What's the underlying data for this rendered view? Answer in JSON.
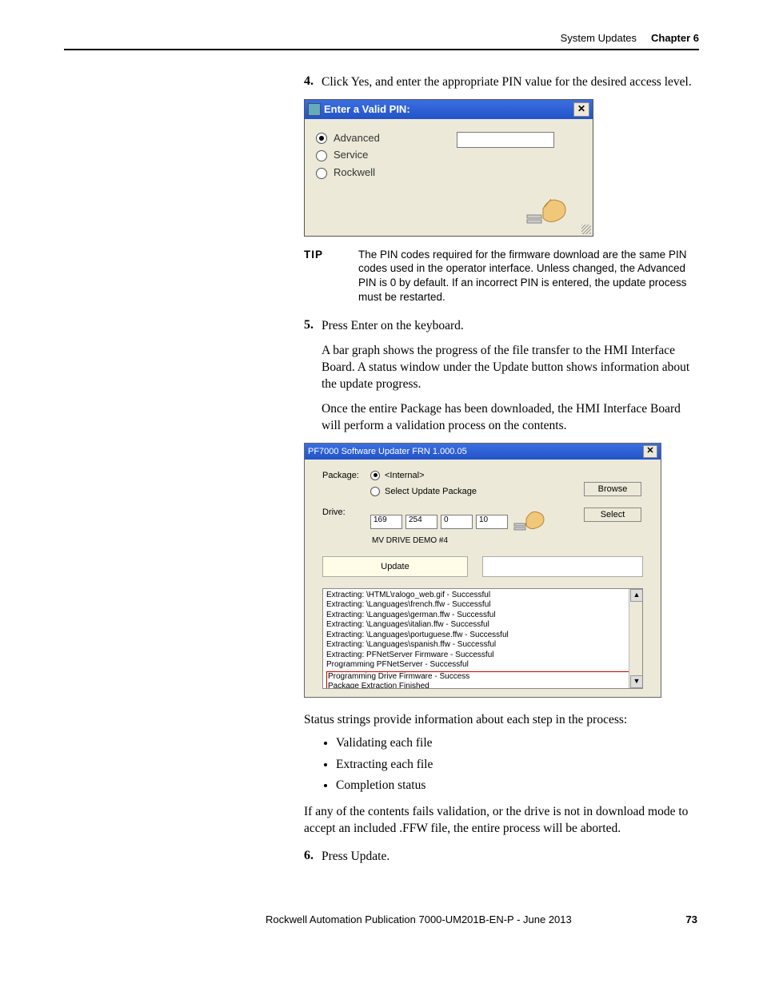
{
  "header": {
    "section": "System Updates",
    "chapter": "Chapter 6"
  },
  "step4": {
    "num": "4.",
    "text": "Click Yes, and enter the appropriate PIN value for the desired access level."
  },
  "dlg1": {
    "title": "Enter a Valid PIN:",
    "close": "✕",
    "opt1": "Advanced",
    "opt2": "Service",
    "opt3": "Rockwell"
  },
  "tip": {
    "label": "TIP",
    "text": "The PIN codes required for the firmware download are the same PIN codes used in the operator interface. Unless changed, the Advanced PIN is 0 by default. If an incorrect PIN is entered, the update process must be restarted."
  },
  "step5": {
    "num": "5.",
    "text": "Press Enter on the keyboard.",
    "p1": "A bar graph shows the progress of the file transfer to the HMI Interface Board. A status window under the Update button shows information about the update progress.",
    "p2": "Once the entire Package has been downloaded, the HMI Interface Board will perform a validation process on the contents."
  },
  "dlg2": {
    "title": "PF7000 Software Updater FRN 1.000.05",
    "close": "✕",
    "pkg_label": "Package:",
    "pkg_opt1": "<Internal>",
    "pkg_opt2": "Select Update Package",
    "browse": "Browse",
    "drive_label": "Drive:",
    "ip": [
      "169",
      "254",
      "0",
      "10"
    ],
    "drive_name": "MV DRIVE DEMO #4",
    "select": "Select",
    "update": "Update",
    "log": [
      "Extracting: \\HTML\\ralogo_web.gif - Successful",
      "Extracting: \\Languages\\french.ffw - Successful",
      "Extracting: \\Languages\\german.ffw - Successful",
      "Extracting: \\Languages\\italian.ffw - Successful",
      "Extracting: \\Languages\\portuguese.ffw - Successful",
      "Extracting: \\Languages\\spanish.ffw - Successful",
      "Extracting: PFNetServer Firmware - Successful",
      "Programming PFNetServer - Successful"
    ],
    "log_boxed1": "Programming Drive Firmware - Success",
    "log_boxed2": "Package Extraction Finished"
  },
  "status_intro": "Status strings provide information about each step in the process:",
  "bullets": {
    "b1": "Validating each file",
    "b2": "Extracting each file",
    "b3": "Completion status"
  },
  "fail_text": "If any of the contents fails validation, or the drive is not in download mode to accept an included .FFW file, the entire process will be aborted.",
  "step6": {
    "num": "6.",
    "text": "Press Update."
  },
  "footer": {
    "pub": "Rockwell Automation Publication 7000-UM201B-EN-P - June 2013",
    "page": "73"
  }
}
